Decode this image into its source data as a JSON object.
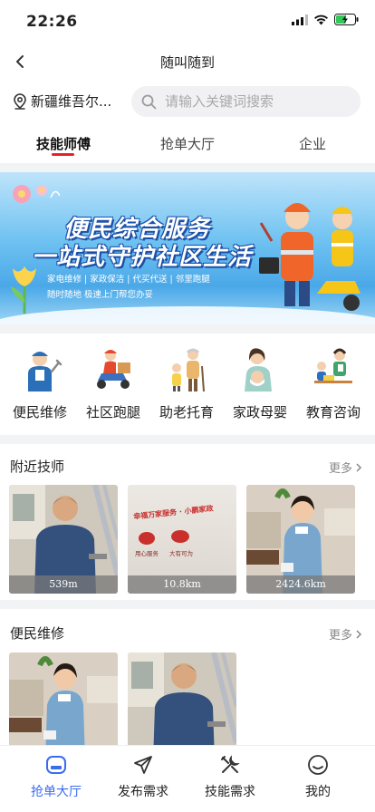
{
  "status": {
    "time": "22:26"
  },
  "nav": {
    "title": "随叫随到"
  },
  "search": {
    "location": "新疆维吾尔...",
    "placeholder": "请输入关键词搜索"
  },
  "top_tabs": [
    {
      "label": "技能师傅",
      "active": true
    },
    {
      "label": "抢单大厅",
      "active": false
    },
    {
      "label": "企业",
      "active": false
    }
  ],
  "banner": {
    "title_line1": "便民综合服务",
    "title_line2": "一站式守护社区生活",
    "subtitle_line1": "家电维修 | 家政保洁 | 代买代送 | 邻里跑腿",
    "subtitle_line2": "随时随地 极速上门帮您办妥"
  },
  "services": [
    {
      "label": "便民维修",
      "icon": "repair-worker-icon"
    },
    {
      "label": "社区跑腿",
      "icon": "delivery-scooter-icon"
    },
    {
      "label": "助老托育",
      "icon": "elderly-care-icon"
    },
    {
      "label": "家政母婴",
      "icon": "mother-baby-icon"
    },
    {
      "label": "教育咨询",
      "icon": "education-icon"
    }
  ],
  "nearby": {
    "title": "附近技师",
    "more": "更多",
    "cards": [
      {
        "distance": "539m",
        "image": "technician-photo"
      },
      {
        "distance": "10.8km",
        "image": "company-wall-photo"
      },
      {
        "distance": "2424.6km",
        "image": "housekeeper-photo"
      }
    ],
    "wall_text_line1": "幸福万家服务 · 小鹏家政",
    "wall_text_line2a": "用心服务",
    "wall_text_line2b": "大有可为"
  },
  "repair": {
    "title": "便民维修",
    "more": "更多",
    "cards": [
      {
        "image": "housekeeper-photo"
      },
      {
        "image": "technician-photo"
      }
    ]
  },
  "tabbar": [
    {
      "label": "抢单大厅",
      "icon": "hall-icon",
      "active": true
    },
    {
      "label": "发布需求",
      "icon": "send-icon",
      "active": false
    },
    {
      "label": "技能需求",
      "icon": "tools-icon",
      "active": false
    },
    {
      "label": "我的",
      "icon": "smile-icon",
      "active": false
    }
  ],
  "colors": {
    "accent": "#3a6cf0",
    "tab_underline": "#e6212a",
    "banner_blue": "#4aa8e8"
  }
}
